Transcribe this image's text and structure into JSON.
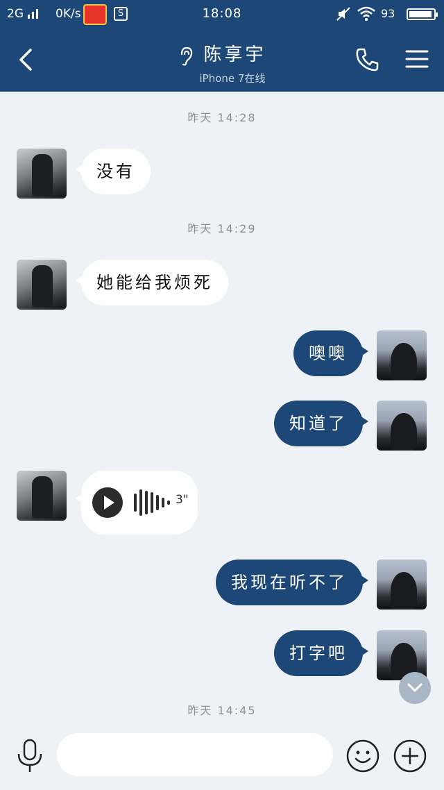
{
  "status_bar": {
    "network": "2G",
    "speed": "0K/s",
    "time": "18:08",
    "battery_percent": "93",
    "battery_level": 0.93
  },
  "header": {
    "contact_name": "陈享宇",
    "device_status": "iPhone 7在线"
  },
  "messages": [
    {
      "type": "timestamp",
      "text": "昨天 14:28"
    },
    {
      "type": "text",
      "from": "them",
      "text": "没有"
    },
    {
      "type": "timestamp",
      "text": "昨天 14:29"
    },
    {
      "type": "text",
      "from": "them",
      "text": "她能给我烦死"
    },
    {
      "type": "text",
      "from": "me",
      "text": "噢噢"
    },
    {
      "type": "text",
      "from": "me",
      "text": "知道了"
    },
    {
      "type": "voice",
      "from": "them",
      "duration": "3\""
    },
    {
      "type": "text",
      "from": "me",
      "text": "我现在听不了"
    },
    {
      "type": "text",
      "from": "me",
      "text": "打字吧"
    },
    {
      "type": "timestamp",
      "text": "昨天 14:45"
    }
  ],
  "input": {
    "placeholder": ""
  },
  "icons": {
    "back": "chevron-left-icon",
    "ear": "ear-icon",
    "phone": "phone-icon",
    "menu": "menu-icon",
    "mic": "microphone-icon",
    "emoji": "emoji-icon",
    "plus": "plus-icon",
    "scroll": "chevron-down-icon",
    "play": "play-icon"
  },
  "colors": {
    "accent": "#1c4776",
    "background": "#eef1f5"
  }
}
